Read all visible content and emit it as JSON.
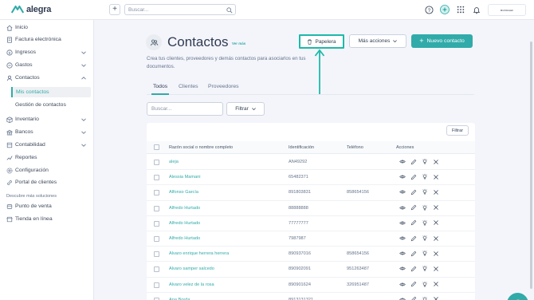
{
  "brand": {
    "name": "alegra",
    "accent": "#30aba9",
    "highlight": "#1db9aa"
  },
  "topbar": {
    "search_placeholder": "Buscar...",
    "icons": [
      "plus-icon",
      "help-icon",
      "ai-assistant-icon",
      "apps-grid-icon",
      "bell-icon"
    ],
    "company_label": "MUNDALEF"
  },
  "sidebar": {
    "items": [
      {
        "label": "Inicio",
        "icon": "home-icon"
      },
      {
        "label": "Factura electrónica",
        "icon": "invoice-icon"
      },
      {
        "label": "Ingresos",
        "icon": "income-icon",
        "expandable": true
      },
      {
        "label": "Gastos",
        "icon": "expenses-icon",
        "expandable": true
      },
      {
        "label": "Contactos",
        "icon": "contacts-icon",
        "expandable": true,
        "expanded": true
      },
      {
        "label": "Inventario",
        "icon": "inventory-icon",
        "expandable": true
      },
      {
        "label": "Bancos",
        "icon": "bank-icon",
        "expandable": true
      },
      {
        "label": "Contabilidad",
        "icon": "accounting-icon",
        "expandable": true
      },
      {
        "label": "Reportes",
        "icon": "reports-icon"
      },
      {
        "label": "Configuración",
        "icon": "settings-icon"
      },
      {
        "label": "Portal de clientes",
        "icon": "portal-icon"
      }
    ],
    "contactos_sub": [
      "Mis contactos",
      "Gestión de contactos"
    ],
    "discover_label": "Descubre más soluciones",
    "solutions": [
      {
        "label": "Punto de venta",
        "icon": "pos-icon"
      },
      {
        "label": "Tienda en línea",
        "icon": "store-icon"
      }
    ]
  },
  "page": {
    "title": "Contactos",
    "ver_mas": "Ver más",
    "description": "Crea tus clientes, proveedores y demás contactos para asociarlos en tus documentos.",
    "btn_papelera": "Papelera",
    "btn_mas_acciones": "Más acciones",
    "btn_nuevo": "Nuevo contacto",
    "tabs": [
      "Todos",
      "Clientes",
      "Proveedores"
    ],
    "search_placeholder": "Buscar...",
    "filtrar": "Filtrar",
    "filtrar_small": "Filtrar"
  },
  "table": {
    "columns": [
      "Razón social o nombre completo",
      "Identificación",
      "Teléfono",
      "Acciones"
    ],
    "rows": [
      {
        "name": "aleja",
        "id": "AN49292",
        "tel": ""
      },
      {
        "name": "Alessia Mamani",
        "id": "65482371",
        "tel": ""
      },
      {
        "name": "Alfonso García",
        "id": "891803831",
        "tel": "858654156"
      },
      {
        "name": "Alfredo Hurtado",
        "id": "88888888",
        "tel": ""
      },
      {
        "name": "Alfredo Hurtado",
        "id": "77777777",
        "tel": ""
      },
      {
        "name": "Alfredo Hurtado",
        "id": "7987987",
        "tel": ""
      },
      {
        "name": "Alvaro enrique herrera herrera",
        "id": "890937016",
        "tel": "858654156"
      },
      {
        "name": "Alvaro samper salcedo",
        "id": "890902091",
        "tel": "951263487"
      },
      {
        "name": "Alvaro velez de la rosa",
        "id": "890901624",
        "tel": "326951487"
      },
      {
        "name": "Ana Borda",
        "id": "8913131321",
        "tel": ""
      }
    ],
    "row_actions": [
      "view-icon",
      "edit-icon",
      "deactivate-icon",
      "delete-icon"
    ]
  }
}
